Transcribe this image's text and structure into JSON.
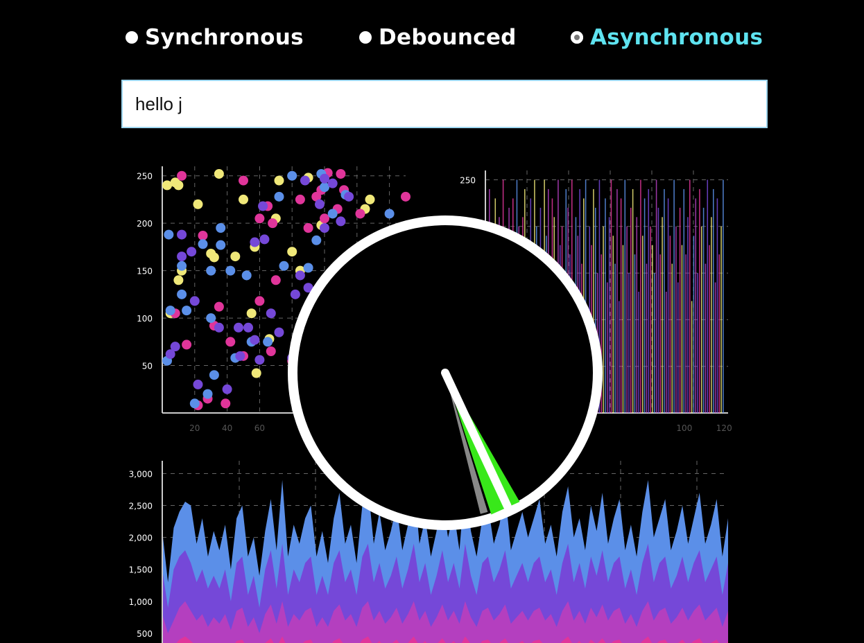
{
  "modes": {
    "sync_label": "Synchronous",
    "debounced_label": "Debounced",
    "async_label": "Asynchronous",
    "selected": "Asynchronous"
  },
  "input": {
    "value": "hello j"
  },
  "colors": {
    "yellow": "#f0e879",
    "pink": "#e0359a",
    "blue": "#5b8fe8",
    "purple": "#7548d8",
    "magenta": "#b43fbf",
    "accent": "#5ee3f0",
    "gauge_needle": "#ffffff",
    "gauge_sweep": "#38e81a"
  },
  "chart_data": [
    {
      "type": "scatter",
      "yticks": [
        "250",
        "200",
        "150",
        "100",
        "50"
      ],
      "xticks": [
        "20",
        "40",
        "60"
      ],
      "ylim": [
        0,
        260
      ],
      "xlim": [
        0,
        150
      ],
      "grid": true,
      "series": [
        {
          "values": [
            [
              3,
              240
            ],
            [
              8,
              243
            ],
            [
              22,
              220
            ],
            [
              35,
              252
            ],
            [
              50,
              225
            ],
            [
              72,
              245
            ],
            [
              90,
              248
            ],
            [
              128,
              225
            ],
            [
              125,
              215
            ],
            [
              70,
              205
            ],
            [
              45,
              165
            ],
            [
              30,
              168
            ],
            [
              12,
              150
            ],
            [
              10,
              140
            ],
            [
              57,
              175
            ],
            [
              80,
              170
            ],
            [
              85,
              150
            ],
            [
              115,
              160
            ],
            [
              140,
              175
            ],
            [
              55,
              105
            ],
            [
              66,
              78
            ],
            [
              58,
              42
            ],
            [
              5,
              105
            ],
            [
              150,
              180
            ],
            [
              98,
              198
            ],
            [
              10,
              240
            ],
            [
              32,
              164
            ]
          ]
        },
        {
          "values": [
            [
              12,
              250
            ],
            [
              50,
              245
            ],
            [
              102,
              253
            ],
            [
              110,
              252
            ],
            [
              65,
              218
            ],
            [
              85,
              225
            ],
            [
              112,
              235
            ],
            [
              60,
              205
            ],
            [
              68,
              200
            ],
            [
              98,
              235
            ],
            [
              95,
              228
            ],
            [
              25,
              187
            ],
            [
              70,
              140
            ],
            [
              8,
              105
            ],
            [
              60,
              118
            ],
            [
              32,
              92
            ],
            [
              42,
              75
            ],
            [
              35,
              112
            ],
            [
              15,
              72
            ],
            [
              22,
              8
            ],
            [
              28,
              15
            ],
            [
              39,
              10
            ],
            [
              50,
              60
            ],
            [
              67,
              65
            ],
            [
              80,
              55
            ],
            [
              88,
              38
            ],
            [
              95,
              25
            ],
            [
              150,
              228
            ],
            [
              108,
              215
            ],
            [
              122,
              210
            ],
            [
              100,
              205
            ],
            [
              90,
              195
            ]
          ]
        },
        {
          "values": [
            [
              4,
              188
            ],
            [
              25,
              178
            ],
            [
              36,
              177
            ],
            [
              36,
              195
            ],
            [
              72,
              228
            ],
            [
              80,
              250
            ],
            [
              98,
              252
            ],
            [
              100,
              238
            ],
            [
              113,
              230
            ],
            [
              140,
              210
            ],
            [
              5,
              108
            ],
            [
              12,
              155
            ],
            [
              15,
              108
            ],
            [
              30,
              100
            ],
            [
              32,
              40
            ],
            [
              28,
              20
            ],
            [
              45,
              58
            ],
            [
              52,
              145
            ],
            [
              65,
              75
            ],
            [
              75,
              155
            ],
            [
              90,
              153
            ],
            [
              95,
              182
            ],
            [
              42,
              150
            ],
            [
              55,
              75
            ],
            [
              20,
              10
            ],
            [
              105,
              210
            ],
            [
              12,
              125
            ],
            [
              3,
              55
            ],
            [
              30,
              150
            ]
          ]
        },
        {
          "values": [
            [
              100,
              247
            ],
            [
              105,
              242
            ],
            [
              115,
              228
            ],
            [
              88,
              245
            ],
            [
              97,
              220
            ],
            [
              62,
              218
            ],
            [
              57,
              180
            ],
            [
              63,
              183
            ],
            [
              12,
              188
            ],
            [
              20,
              118
            ],
            [
              35,
              90
            ],
            [
              47,
              90
            ],
            [
              53,
              90
            ],
            [
              57,
              77
            ],
            [
              67,
              105
            ],
            [
              72,
              85
            ],
            [
              80,
              58
            ],
            [
              82,
              125
            ],
            [
              90,
              132
            ],
            [
              85,
              145
            ],
            [
              5,
              62
            ],
            [
              22,
              30
            ],
            [
              40,
              25
            ],
            [
              12,
              165
            ],
            [
              18,
              170
            ],
            [
              48,
              60
            ],
            [
              60,
              56
            ],
            [
              100,
              195
            ],
            [
              110,
              202
            ],
            [
              8,
              70
            ]
          ]
        }
      ]
    },
    {
      "type": "bar",
      "yticks": [
        "250"
      ],
      "xticks": [
        "100",
        "120"
      ],
      "ylim": [
        0,
        260
      ],
      "xlim": [
        0,
        122
      ],
      "grid": true,
      "values": [
        240,
        200,
        150,
        230,
        180,
        210,
        120,
        250,
        170,
        140,
        220,
        190,
        230,
        160,
        250,
        200,
        120,
        210,
        240,
        180,
        150,
        230,
        130,
        250,
        200,
        170,
        220,
        140,
        250,
        190,
        240,
        160,
        230,
        210,
        120,
        250,
        180,
        200,
        150,
        240,
        220,
        170,
        250,
        130,
        210,
        190,
        240,
        160,
        230,
        250,
        110,
        200,
        180,
        240,
        220,
        150,
        250,
        170,
        200,
        230,
        140,
        210,
        250,
        190,
        160,
        240,
        120,
        230,
        180,
        250,
        200,
        150,
        220,
        240,
        170,
        210,
        130,
        250,
        190,
        230,
        160,
        240,
        200,
        180,
        150,
        250,
        220,
        170,
        210,
        240,
        130,
        230,
        190,
        160,
        250,
        200,
        140,
        220,
        180,
        240,
        170,
        210,
        250,
        120,
        190,
        230,
        150,
        240,
        200,
        220,
        160,
        250,
        180,
        210,
        240,
        140,
        230,
        170,
        200,
        250
      ]
    },
    {
      "type": "area",
      "yticks": [
        "3,000",
        "2,500",
        "2,000",
        "1,500",
        "1,000",
        "500"
      ],
      "ylim": [
        0,
        3200
      ],
      "grid": true,
      "series": [
        {
          "values": [
            2100,
            1300,
            2150,
            2400,
            2560,
            2500,
            1900,
            2300,
            1700,
            2100,
            1800,
            2200,
            1500,
            2300,
            2500,
            1700,
            2000,
            1400,
            2100,
            2600,
            1800,
            2900,
            1700,
            2200,
            1900,
            2300,
            2500,
            1700,
            2100,
            1600,
            2300,
            2700,
            1900,
            2200,
            1600,
            2500,
            2800,
            1900,
            2400,
            1800,
            2100,
            2500,
            1800,
            2200,
            2900,
            1900,
            2300,
            1700,
            2100,
            2600,
            2000,
            2400,
            1800,
            2900,
            2100,
            1700,
            2300,
            2500,
            1900,
            2200,
            2700,
            1800,
            2100,
            2400,
            2000,
            2300,
            2600,
            1900,
            2200,
            1700,
            2400,
            2800,
            2000,
            2300,
            1800,
            2500,
            2100,
            2700,
            1900,
            2300,
            2600,
            1800,
            2200,
            1700,
            2400,
            2900,
            2000,
            2300,
            2600,
            1800,
            2100,
            2500,
            1900,
            2300,
            2700,
            1900,
            2200,
            2600,
            1700,
            2300
          ]
        },
        {
          "values": [
            1500,
            900,
            1500,
            1700,
            1800,
            1600,
            1300,
            1500,
            1200,
            1400,
            1200,
            1500,
            1000,
            1600,
            1700,
            1100,
            1400,
            900,
            1500,
            1800,
            1200,
            1900,
            1100,
            1500,
            1300,
            1600,
            1700,
            1100,
            1400,
            1100,
            1600,
            1800,
            1300,
            1500,
            1100,
            1700,
            1900,
            1300,
            1600,
            1200,
            1400,
            1700,
            1200,
            1500,
            1900,
            1300,
            1600,
            1100,
            1400,
            1800,
            1300,
            1600,
            1200,
            1900,
            1400,
            1100,
            1600,
            1700,
            1300,
            1500,
            1800,
            1200,
            1400,
            1600,
            1300,
            1600,
            1700,
            1300,
            1500,
            1100,
            1600,
            1900,
            1300,
            1600,
            1200,
            1700,
            1400,
            1800,
            1300,
            1600,
            1700,
            1200,
            1500,
            1100,
            1600,
            1900,
            1300,
            1600,
            1700,
            1200,
            1400,
            1700,
            1300,
            1600,
            1800,
            1300,
            1500,
            1700,
            1100,
            1600
          ]
        },
        {
          "values": [
            800,
            500,
            700,
            900,
            1000,
            850,
            700,
            800,
            600,
            750,
            650,
            800,
            550,
            850,
            900,
            600,
            750,
            500,
            800,
            950,
            650,
            1000,
            600,
            800,
            700,
            850,
            900,
            600,
            750,
            600,
            850,
            950,
            700,
            800,
            600,
            900,
            1000,
            700,
            850,
            650,
            750,
            900,
            650,
            800,
            1000,
            700,
            850,
            600,
            750,
            950,
            700,
            850,
            650,
            1000,
            750,
            600,
            850,
            900,
            700,
            800,
            950,
            650,
            750,
            850,
            700,
            850,
            900,
            700,
            800,
            600,
            850,
            1000,
            700,
            850,
            650,
            900,
            750,
            950,
            700,
            850,
            900,
            650,
            800,
            600,
            850,
            1000,
            700,
            850,
            900,
            650,
            750,
            900,
            700,
            850,
            950,
            700,
            800,
            900,
            600,
            850
          ]
        },
        {
          "values": [
            350,
            250,
            300,
            400,
            450,
            380,
            300,
            350,
            250,
            330,
            280,
            350,
            240,
            380,
            400,
            260,
            330,
            220,
            350,
            420,
            280,
            450,
            260,
            350,
            300,
            380,
            400,
            260,
            330,
            260,
            380,
            420,
            300,
            350,
            260,
            400,
            450,
            300,
            380,
            280,
            330,
            400,
            280,
            350,
            450,
            300,
            380,
            260,
            330,
            420,
            300,
            380,
            280,
            450,
            330,
            260,
            380,
            400,
            300,
            350,
            420,
            280,
            330,
            380,
            300,
            380,
            400,
            300,
            350,
            260,
            380,
            450,
            300,
            380,
            280,
            400,
            330,
            420,
            300,
            380,
            400,
            280,
            350,
            260,
            380,
            450,
            300,
            380,
            400,
            280,
            330,
            400,
            300,
            380,
            420,
            300,
            350,
            400,
            260,
            380
          ]
        }
      ]
    }
  ],
  "gauge": {
    "needle_deg": 155,
    "sweep_from_deg": 150,
    "sweep_to_deg": 162
  }
}
